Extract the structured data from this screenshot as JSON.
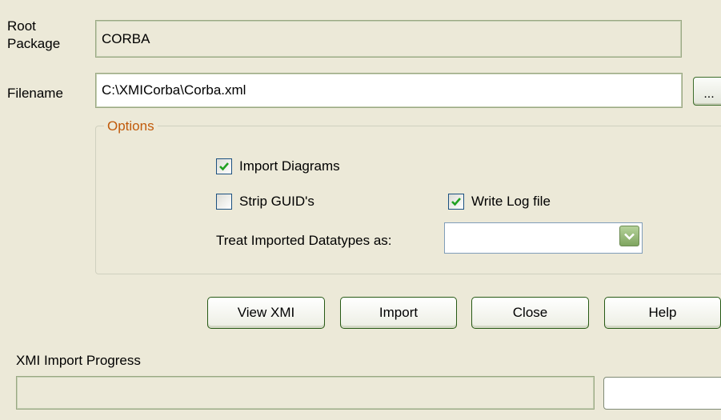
{
  "root_package": {
    "label": "Root Package",
    "value": "CORBA"
  },
  "filename": {
    "label": "Filename",
    "value": "C:\\XMICorba\\Corba.xml",
    "browse_label": "..."
  },
  "options": {
    "legend": "Options",
    "import_diagrams": {
      "label": "Import Diagrams",
      "checked": true
    },
    "strip_guids": {
      "label": "Strip GUID's",
      "checked": false
    },
    "write_log_file": {
      "label": "Write Log file",
      "checked": true
    },
    "treat_datatypes": {
      "label": "Treat Imported Datatypes as:",
      "value": ""
    }
  },
  "buttons": {
    "view_xmi": "View XMI",
    "import": "Import",
    "close": "Close",
    "help": "Help"
  },
  "progress": {
    "label": "XMI Import Progress",
    "fraction": 0,
    "status": ""
  },
  "colors": {
    "checkmark": "#21a121",
    "legend": "#c15a0b",
    "dropdown": "#8fb872"
  }
}
